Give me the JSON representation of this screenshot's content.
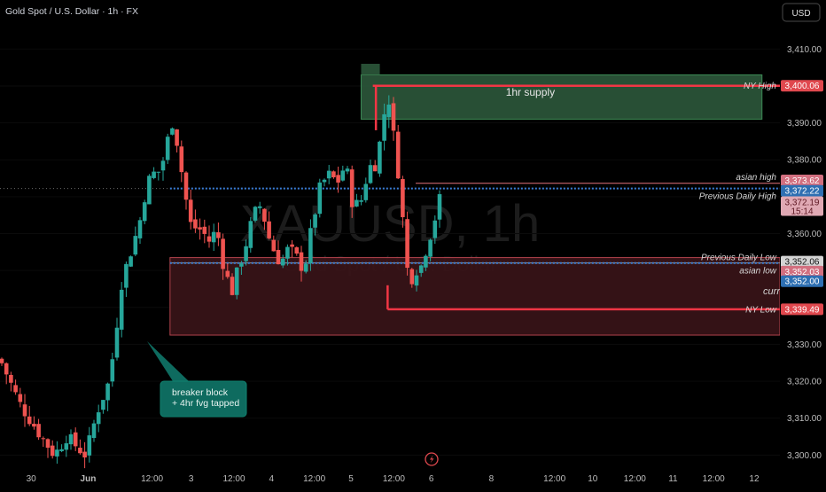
{
  "header": {
    "title": "Gold Spot / U.S. Dollar · 1h · FX"
  },
  "currency_button": {
    "label": "USD"
  },
  "watermark": {
    "symbol": "XAUUSD, 1h",
    "name": "Gold Spot / U.S. Dollar"
  },
  "zones": {
    "supply_label": "1hr supply",
    "callout": [
      "breaker block",
      "+ 4hr fvg tapped"
    ]
  },
  "level_labels": {
    "ny_high": "NY High",
    "asian_high": "asian high",
    "prev_daily_high": "Previous Daily High",
    "prev_daily_low": "Previous Daily Low",
    "asian_low": "asian low",
    "curr": "curr",
    "ny_low": "NY Low"
  },
  "price_tags": [
    {
      "key": "ny_high",
      "text": "3,400.06",
      "sub": "",
      "bg": "#e0484e",
      "fg": "#ffffff"
    },
    {
      "key": "t1",
      "text": "3,373.62",
      "sub": "",
      "bg": "#d26f7f",
      "fg": "#ffffff"
    },
    {
      "key": "t2",
      "text": "3,372.22",
      "sub": "",
      "bg": "#2e6fb2",
      "fg": "#ffffff"
    },
    {
      "key": "t3",
      "text": "3,372.19",
      "sub": "15:14",
      "bg": "#e0a9b4",
      "fg": "#5c1621"
    },
    {
      "key": "t4",
      "text": "3,352.06",
      "sub": "",
      "bg": "#d4d4d4",
      "fg": "#111111"
    },
    {
      "key": "t5",
      "text": "3,352.03",
      "sub": "",
      "bg": "#d26f7f",
      "fg": "#ffffff"
    },
    {
      "key": "t6",
      "text": "3,352.00",
      "sub": "",
      "bg": "#2e6fb2",
      "fg": "#ffffff"
    },
    {
      "key": "ny_low",
      "text": "3,339.49",
      "sub": "",
      "bg": "#e0484e",
      "fg": "#ffffff"
    }
  ],
  "colors": {
    "up": "#26a69a",
    "down": "#ef5350",
    "supply_zone": "#2f5d3e",
    "demand_zone": "#3a1418",
    "level_red": "#f23645",
    "level_blue": "#3b7fd9",
    "callout": "#0e6b5f"
  },
  "icons": {
    "replay": "lightning-icon"
  },
  "chart_data": {
    "type": "candlestick",
    "title": "Gold Spot / U.S. Dollar · 1h · FX",
    "ylim": [
      3296,
      3418
    ],
    "y_ticks": [
      3410,
      3400,
      3390,
      3380,
      3370,
      3360,
      3350,
      3340,
      3330,
      3320,
      3310,
      3300
    ],
    "y_tick_labels": [
      "3,410.00",
      "3,400.00",
      "3,390.00",
      "3,380.00",
      "3,370.00",
      "3,360.00",
      "3,350.00",
      "3,340.00",
      "3,330.00",
      "3,320.00",
      "3,310.00",
      "3,300.00"
    ],
    "x_tick_labels": [
      "30",
      "Jun",
      "12:00",
      "3",
      "12:00",
      "4",
      "12:00",
      "5",
      "12:00",
      "6",
      "8",
      "12:00",
      "10",
      "12:00",
      "11",
      "12:00",
      "12"
    ],
    "x_tick_frac": [
      0.04,
      0.113,
      0.195,
      0.245,
      0.3,
      0.348,
      0.403,
      0.45,
      0.505,
      0.553,
      0.63,
      0.711,
      0.76,
      0.814,
      0.863,
      0.915,
      0.967
    ],
    "close_path": [
      [
        0.0,
        3326
      ],
      [
        0.025,
        3314
      ],
      [
        0.05,
        3306
      ],
      [
        0.07,
        3300
      ],
      [
        0.085,
        3305
      ],
      [
        0.1,
        3302
      ],
      [
        0.11,
        3300
      ],
      [
        0.125,
        3312
      ],
      [
        0.14,
        3320
      ],
      [
        0.148,
        3332
      ],
      [
        0.155,
        3346
      ],
      [
        0.163,
        3352
      ],
      [
        0.172,
        3358
      ],
      [
        0.18,
        3364
      ],
      [
        0.187,
        3372
      ],
      [
        0.194,
        3376
      ],
      [
        0.205,
        3377
      ],
      [
        0.212,
        3382
      ],
      [
        0.22,
        3391
      ],
      [
        0.228,
        3384
      ],
      [
        0.236,
        3372
      ],
      [
        0.245,
        3362
      ],
      [
        0.258,
        3361
      ],
      [
        0.268,
        3358
      ],
      [
        0.278,
        3361
      ],
      [
        0.287,
        3351
      ],
      [
        0.297,
        3344
      ],
      [
        0.305,
        3350
      ],
      [
        0.315,
        3357
      ],
      [
        0.325,
        3365
      ],
      [
        0.335,
        3368
      ],
      [
        0.343,
        3360
      ],
      [
        0.352,
        3355
      ],
      [
        0.36,
        3352
      ],
      [
        0.37,
        3356
      ],
      [
        0.382,
        3353
      ],
      [
        0.39,
        3350
      ],
      [
        0.4,
        3362
      ],
      [
        0.41,
        3372
      ],
      [
        0.42,
        3376
      ],
      [
        0.433,
        3374
      ],
      [
        0.443,
        3379
      ],
      [
        0.453,
        3367
      ],
      [
        0.463,
        3369
      ],
      [
        0.473,
        3378
      ],
      [
        0.482,
        3379
      ],
      [
        0.485,
        3382
      ],
      [
        0.491,
        3390
      ],
      [
        0.497,
        3399
      ],
      [
        0.503,
        3389
      ],
      [
        0.511,
        3376
      ],
      [
        0.519,
        3358
      ],
      [
        0.525,
        3344
      ],
      [
        0.531,
        3352
      ],
      [
        0.537,
        3349
      ],
      [
        0.545,
        3355
      ],
      [
        0.552,
        3360
      ],
      [
        0.56,
        3366
      ],
      [
        0.567,
        3372
      ]
    ],
    "series": [
      {
        "name": "NY High",
        "value": 3400.06
      },
      {
        "name": "asian high",
        "value": 3373.62
      },
      {
        "name": "Previous Daily High",
        "value": 3372.22
      },
      {
        "name": "Previous Daily Low",
        "value": 3352.06
      },
      {
        "name": "asian low",
        "value": 3352.03
      },
      {
        "name": "NY Low",
        "value": 3339.49
      }
    ],
    "zones": [
      {
        "name": "1hr supply",
        "from": 3391,
        "to": 3403
      },
      {
        "name": "breaker block + 4hr fvg tapped",
        "from": 3332.5,
        "to": 3353.5
      }
    ]
  }
}
